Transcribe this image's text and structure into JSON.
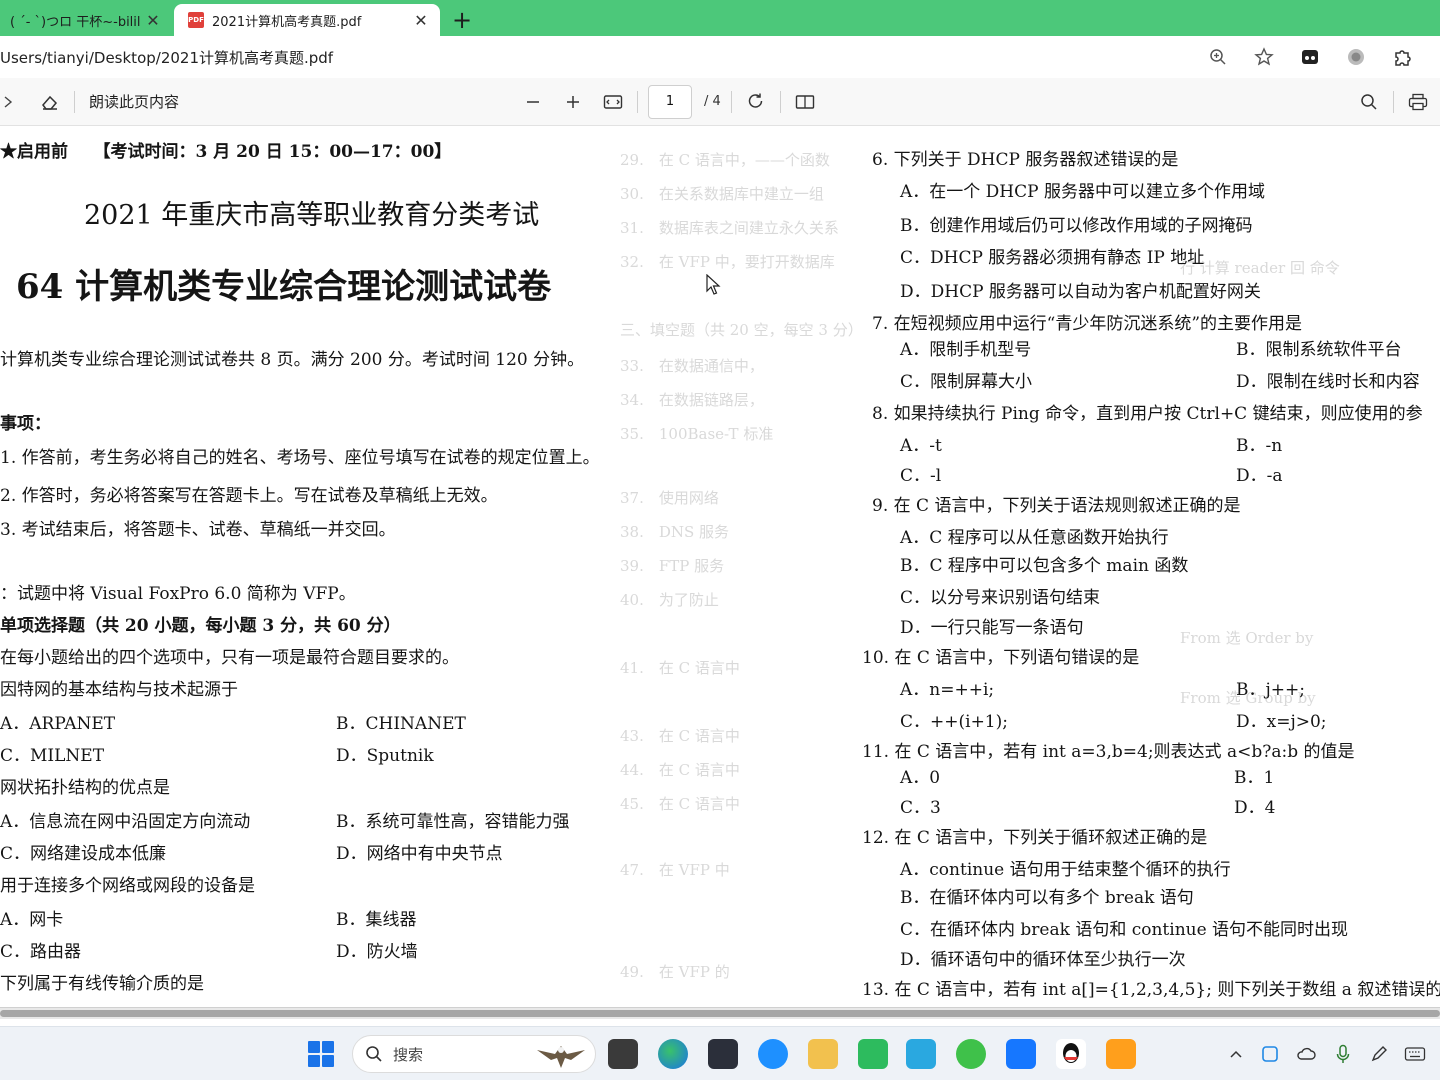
{
  "browser": {
    "tabs": [
      {
        "title": "( ´- `)つロ 干杯~-bilil",
        "close": "✕"
      },
      {
        "title": "2021计算机高考真题.pdf",
        "close": "✕",
        "favicon": "PDF"
      }
    ],
    "new_tab": "+",
    "url": "Users/tianyi/Desktop/2021计算机高考真题.pdf"
  },
  "pdf_toolbar": {
    "read_aloud": "朗读此页内容",
    "page_current": "1",
    "page_total": "/ 4"
  },
  "document": {
    "left": [
      "★启用前　　【考试时间：3 月 20 日 15：00—17：00】",
      "2021 年重庆市高等职业教育分类考试",
      "64 计算机类专业综合理论测试试卷",
      "计算机类专业综合理论测试试卷共 8 页。满分 200 分。考试时间 120 分钟。",
      "事项：",
      "1. 作答前，考生务必将自己的姓名、考场号、座位号填写在试卷的规定位置上。",
      "2. 作答时，务必将答案写在答题卡上。写在试卷及草稿纸上无效。",
      "3. 考试结束后，将答题卡、试卷、草稿纸一并交回。",
      "：试题中将 Visual FoxPro 6.0 简称为 VFP。",
      "单项选择题（共 20 小题，每小题 3 分，共 60 分）",
      "在每小题给出的四个选项中，只有一项是最符合题目要求的。",
      "因特网的基本结构与技术起源于",
      "A．ARPANET",
      "B．CHINANET",
      "C．MILNET",
      "D．Sputnik",
      "网状拓扑结构的优点是",
      "A．信息流在网中沿固定方向流动",
      "B．系统可靠性高，容错能力强",
      "C．网络建设成本低廉",
      "D．网络中有中央节点",
      "用于连接多个网络或网段的设备是",
      "A．网卡",
      "B．集线器",
      "C．路由器",
      "D．防火墙",
      "下列属于有线传输介质的是"
    ],
    "right": [
      "6. 下列关于 DHCP 服务器叙述错误的是",
      "A．在一个 DHCP 服务器中可以建立多个作用域",
      "B．创建作用域后仍可以修改作用域的子网掩码",
      "C．DHCP 服务器必须拥有静态 IP 地址",
      "D．DHCP 服务器可以自动为客户机配置好网关",
      "7. 在短视频应用中运行“青少年防沉迷系统”的主要作用是",
      "A．限制手机型号",
      "B．限制系统软件平台",
      "C．限制屏幕大小",
      "D．限制在线时长和内容",
      "8. 如果持续执行 Ping 命令，直到用户按 Ctrl+C 键结束，则应使用的参",
      "A．-t",
      "B．-n",
      "C．-l",
      "D．-a",
      "9. 在 C 语言中，下列关于语法规则叙述正确的是",
      "A．C 程序可以从任意函数开始执行",
      "B．C 程序中可以包含多个 main 函数",
      "C．以分号来识别语句结束",
      "D．一行只能写一条语句",
      "10. 在 C 语言中，下列语句错误的是",
      "A．n=++i;",
      "B．j++;",
      "C．++(i+1);",
      "D．x=j>0;",
      "11. 在 C 语言中，若有 int a=3,b=4;则表达式 a<b?a:b 的值是",
      "A．0",
      "B．1",
      "C．3",
      "D．4",
      "12. 在 C 语言中，下列关于循环叙述正确的是",
      "A．continue 语句用于结束整个循环的执行",
      "B．在循环体内可以有多个 break 语句",
      "C．在循环体内 break 语句和 continue 语句不能同时出现",
      "D．循环语句中的循环体至少执行一次",
      "13. 在 C 语言中，若有 int a[]={1,2,3,4,5}; 则下列关于数组 a 叙述错误的"
    ]
  },
  "taskbar": {
    "search_placeholder": "搜索"
  },
  "colors": {
    "tab_bar": "#4cc87a",
    "taskbar": "#eef2f7",
    "pdf_red": "#e0403a"
  }
}
